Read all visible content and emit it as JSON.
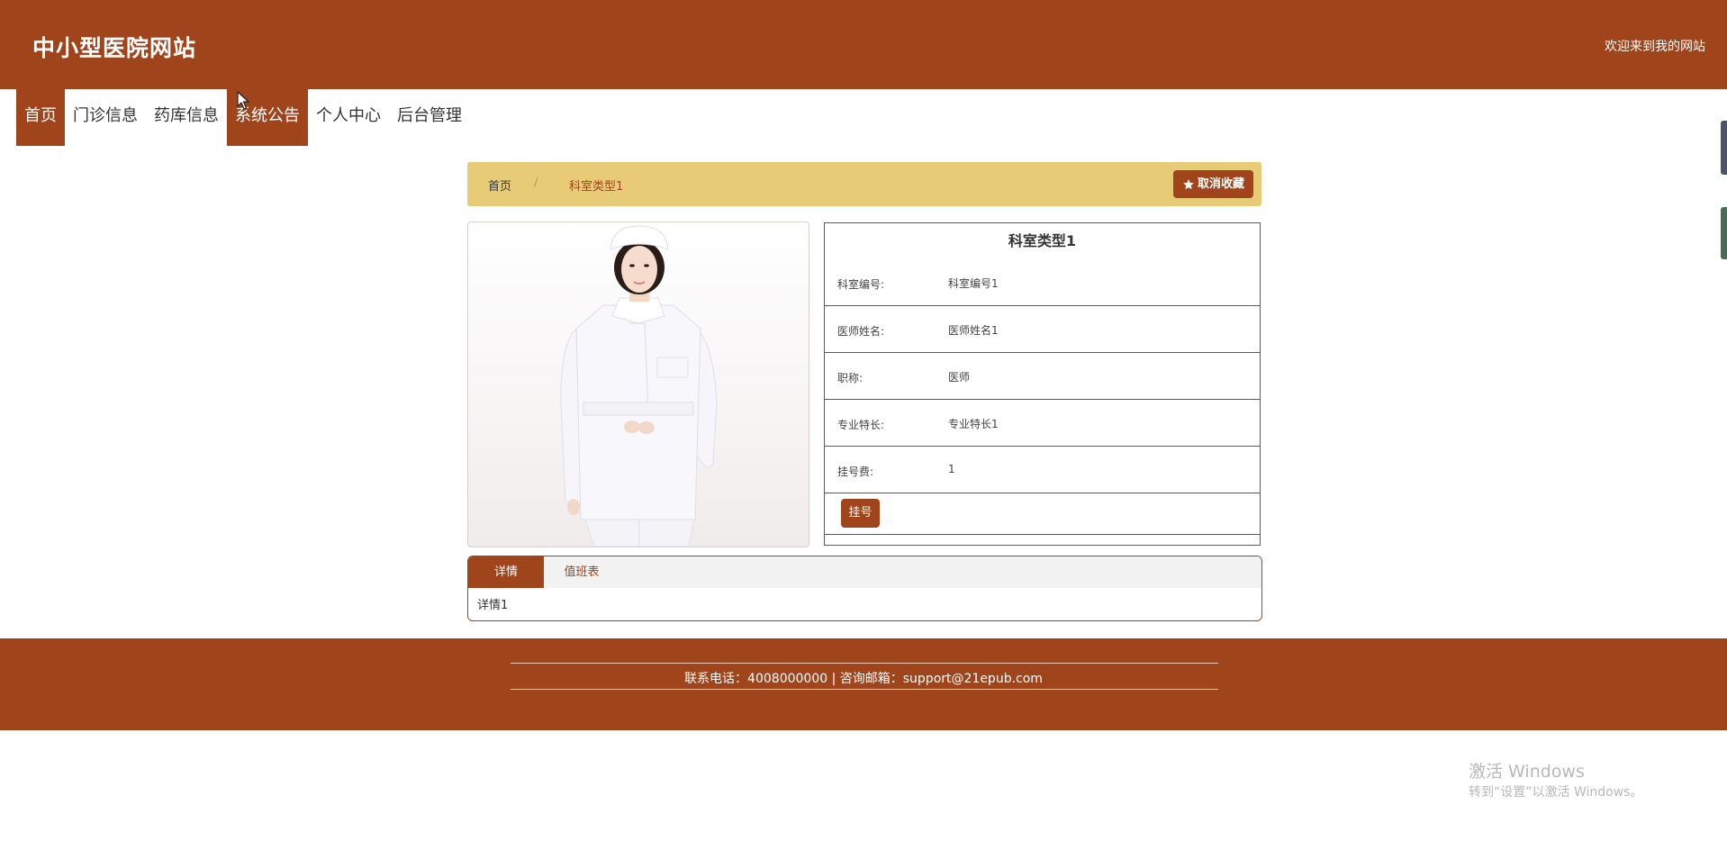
{
  "header": {
    "site_title": "中小型医院网站",
    "welcome": "欢迎来到我的网站"
  },
  "nav": {
    "items": [
      {
        "label": "首页",
        "active": true
      },
      {
        "label": "门诊信息",
        "active": false
      },
      {
        "label": "药库信息",
        "active": false
      },
      {
        "label": "系统公告",
        "active": true
      },
      {
        "label": "个人中心",
        "active": false
      },
      {
        "label": "后台管理",
        "active": false
      }
    ]
  },
  "breadcrumb": {
    "home": "首页",
    "separator": "/",
    "current": "科室类型1",
    "favorite_button": "取消收藏",
    "favorite_icon": "star-icon"
  },
  "detail": {
    "title": "科室类型1",
    "fields": [
      {
        "label": "科室编号:",
        "value": "科室编号1"
      },
      {
        "label": "医师姓名:",
        "value": "医师姓名1"
      },
      {
        "label": "职称:",
        "value": "医师"
      },
      {
        "label": "专业特长:",
        "value": "专业特长1"
      },
      {
        "label": "挂号费:",
        "value": "1"
      }
    ],
    "register_button": "挂号"
  },
  "tabs": {
    "items": [
      {
        "label": "详情",
        "active": true
      },
      {
        "label": "值班表",
        "active": false
      }
    ],
    "content": "详情1"
  },
  "footer": {
    "contact": "联系电话：4008000000 | 咨询邮箱：support@21epub.com"
  },
  "watermark": {
    "title": "激活 Windows",
    "subtitle": "转到“设置”以激活 Windows。"
  },
  "colors": {
    "brand": "#a0441c",
    "crumb_bg": "#e8cb76"
  }
}
